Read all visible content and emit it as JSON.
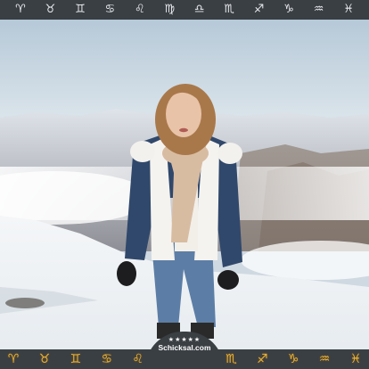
{
  "top_bar": {
    "signs": [
      {
        "name": "aries",
        "glyph": "♈︎"
      },
      {
        "name": "taurus",
        "glyph": "♉︎"
      },
      {
        "name": "gemini",
        "glyph": "♊︎"
      },
      {
        "name": "cancer",
        "glyph": "♋︎"
      },
      {
        "name": "leo",
        "glyph": "♌︎"
      },
      {
        "name": "virgo",
        "glyph": "♍︎"
      },
      {
        "name": "libra",
        "glyph": "♎︎"
      },
      {
        "name": "scorpio",
        "glyph": "♏︎"
      },
      {
        "name": "sagittarius",
        "glyph": "♐︎"
      },
      {
        "name": "capricorn",
        "glyph": "♑︎"
      },
      {
        "name": "aquarius",
        "glyph": "♒︎"
      },
      {
        "name": "pisces",
        "glyph": "♓︎"
      }
    ]
  },
  "bottom_bar": {
    "icons": [
      {
        "name": "ram-gold-icon",
        "glyph": "♈"
      },
      {
        "name": "bull-gold-icon",
        "glyph": "♉"
      },
      {
        "name": "twins-gold-icon",
        "glyph": "♊"
      },
      {
        "name": "crab-gold-icon",
        "glyph": "♋"
      },
      {
        "name": "lion-gold-icon",
        "glyph": "♌"
      },
      {
        "name": "maiden-gold-icon",
        "glyph": "♍"
      },
      {
        "name": "scales-gold-icon",
        "glyph": "♎"
      },
      {
        "name": "scorpion-gold-icon",
        "glyph": "♏"
      },
      {
        "name": "archer-gold-icon",
        "glyph": "♐"
      },
      {
        "name": "goat-gold-icon",
        "glyph": "♑"
      },
      {
        "name": "water-bearer-gold-icon",
        "glyph": "♒"
      },
      {
        "name": "fish-gold-icon",
        "glyph": "♓"
      }
    ]
  },
  "logo": {
    "stars": "★★★★★",
    "brand": "Schicksal.com"
  },
  "colors": {
    "bar_background": "#3a3f44",
    "gold": "#e7b43c"
  }
}
